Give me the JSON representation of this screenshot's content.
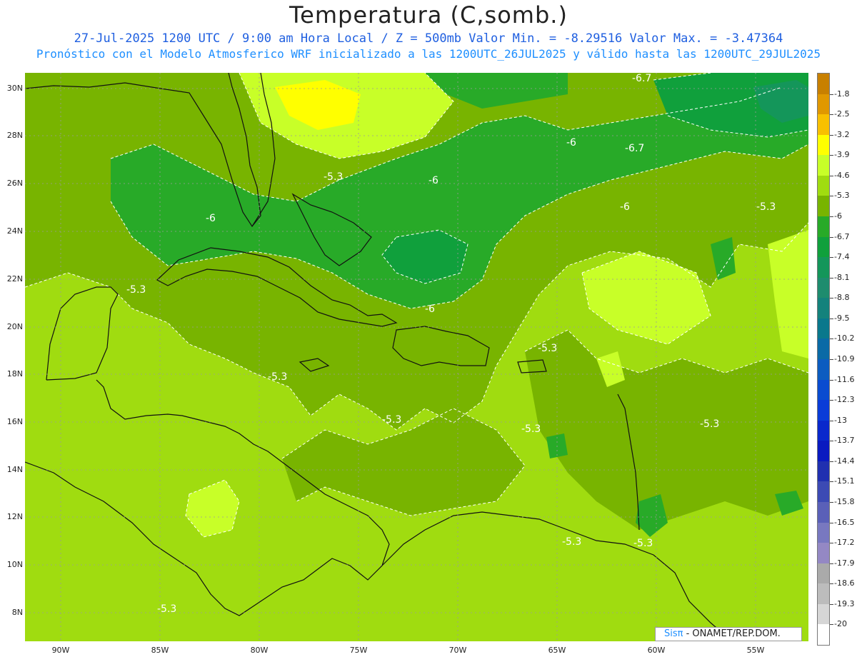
{
  "title": "Temperatura (C,somb.)",
  "subtitle_line1": "27-Jul-2025   1200 UTC / 9:00 am Hora Local / Z = 500mb  Valor Min. = -8.29516  Valor Max. = -3.47364",
  "subtitle_line2": "Pronóstico con el Modelo Atmosferico WRF inicializado a las 1200UTC_26JUL2025 y válido hasta las  1200UTC_29JUL2025",
  "lat_labels": [
    "30N",
    "28N",
    "26N",
    "24N",
    "22N",
    "20N",
    "18N",
    "16N",
    "14N",
    "12N",
    "10N",
    "8N"
  ],
  "lon_labels": [
    "90W",
    "85W",
    "80W",
    "75W",
    "70W",
    "65W",
    "60W",
    "55W"
  ],
  "colorbar": {
    "labels": [
      "-1.8",
      "-2.5",
      "-3.2",
      "-3.9",
      "-4.6",
      "-5.3",
      "-6",
      "-6.7",
      "-7.4",
      "-8.1",
      "-8.8",
      "-9.5",
      "-10.2",
      "-10.9",
      "-11.6",
      "-12.3",
      "-13",
      "-13.7",
      "-14.4",
      "-15.1",
      "-15.8",
      "-16.5",
      "-17.2",
      "-17.9",
      "-18.6",
      "-19.3",
      "-20"
    ],
    "colors": [
      "#c88000",
      "#e09800",
      "#f8c000",
      "#ffff00",
      "#c8ff28",
      "#a0dc10",
      "#78b400",
      "#28aa28",
      "#10a03c",
      "#14965a",
      "#1e8c6e",
      "#14827c",
      "#0a788c",
      "#0a6aa6",
      "#0c5cc0",
      "#0a4cd0",
      "#0a3cd8",
      "#0a28cc",
      "#0a1ac0",
      "#2030b0",
      "#3c4ab4",
      "#5a60b8",
      "#7878c0",
      "#9488c4",
      "#aaaaaa",
      "#bcbcbc",
      "#d6d6d6",
      "#ffffff"
    ]
  },
  "contour_labels": [
    {
      "text": "-6.7"
    },
    {
      "text": "-6"
    },
    {
      "text": "-6.7"
    },
    {
      "text": "-5.3"
    },
    {
      "text": "-6"
    },
    {
      "text": "-6"
    },
    {
      "text": "-6"
    },
    {
      "text": "-5.3"
    },
    {
      "text": "-5.3"
    },
    {
      "text": "-6"
    },
    {
      "text": "-5.3"
    },
    {
      "text": "-5.3"
    },
    {
      "text": "-5.3"
    },
    {
      "text": "-5.3"
    },
    {
      "text": "-5.3"
    },
    {
      "text": "-5.3"
    },
    {
      "text": "-5.3"
    },
    {
      "text": "-5.3"
    }
  ],
  "credit": {
    "brand": "Sisπ",
    "text": " - ONAMET/REP.DOM."
  }
}
